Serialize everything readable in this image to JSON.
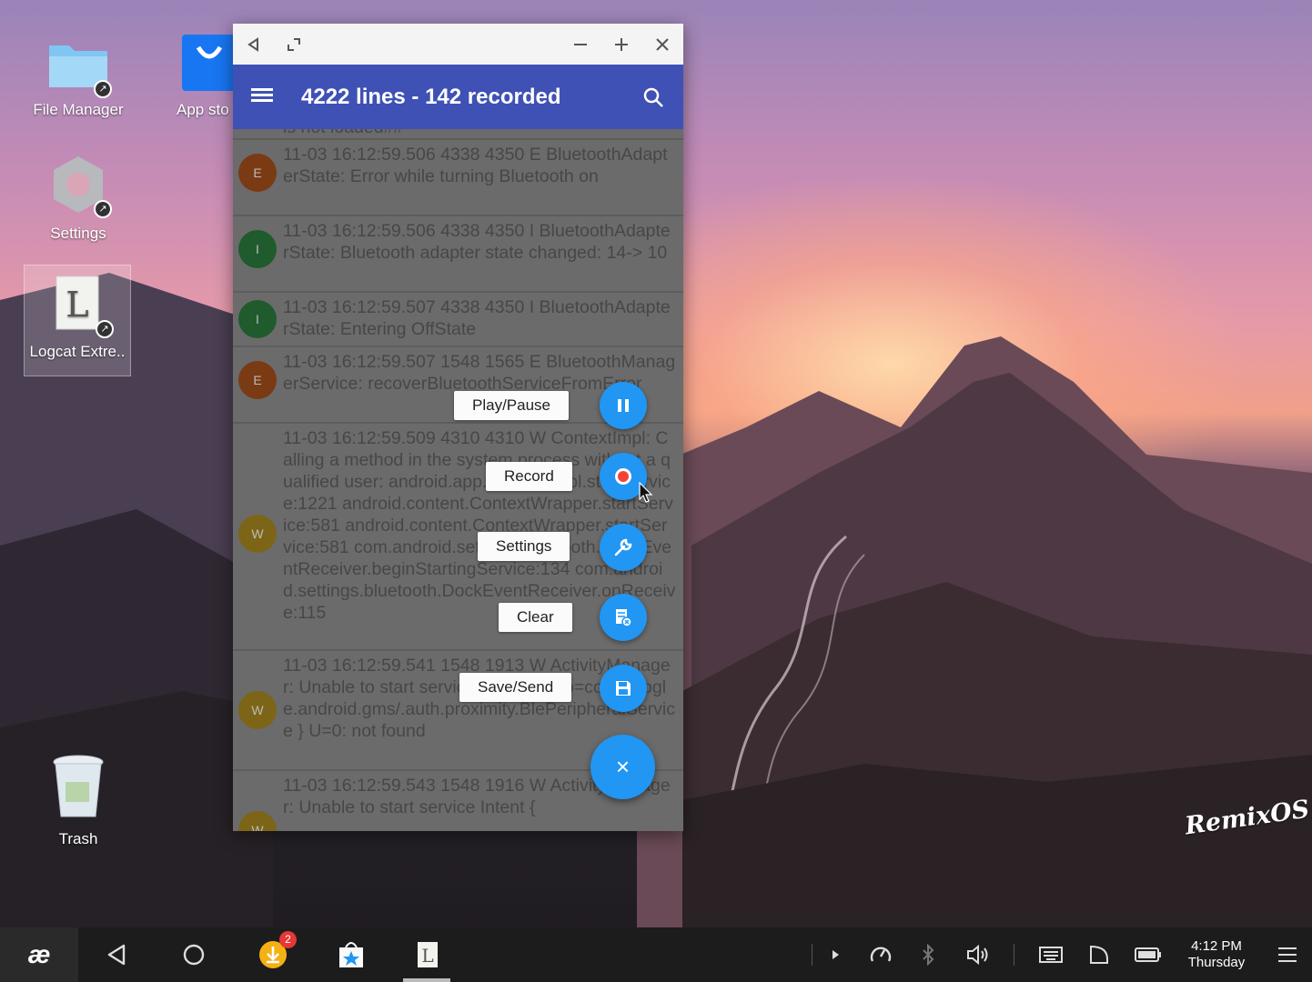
{
  "desktop": {
    "icons": [
      {
        "label": "File Manager"
      },
      {
        "label": "App sto"
      },
      {
        "label": "Settings"
      },
      {
        "label": "Logcat Extre.."
      },
      {
        "label": "Trash"
      }
    ],
    "brand": "RemixOS"
  },
  "window": {
    "title": "4222 lines - 142 recorded",
    "partial_top_line": "is not loaded##",
    "logs": [
      {
        "level": "E",
        "text": "11-03 16:12:59.506  4338  4350 E BluetoothAdapterState: Error while turning Bluetooth on"
      },
      {
        "level": "I",
        "text": "11-03 16:12:59.506  4338  4350 I BluetoothAdapterState: Bluetooth adapter state changed: 14-> 10"
      },
      {
        "level": "I",
        "text": "11-03 16:12:59.507  4338  4350 I BluetoothAdapterState: Entering OffState"
      },
      {
        "level": "E",
        "text": "11-03 16:12:59.507  1548  1565 E BluetoothManagerService: recoverBluetoothServiceFromError"
      },
      {
        "level": "W",
        "text": "11-03 16:12:59.509  4310  4310 W ContextImpl: Calling a method in the system process without a qualified user: android.app.ContextImpl.startService:1221 android.content.ContextWrapper.startService:581 android.content.ContextWrapper.startService:581 com.android.settings.bluetooth.DockEventReceiver.beginStartingService:134 com.android.settings.bluetooth.DockEventReceiver.onReceive:115"
      },
      {
        "level": "W",
        "text": "11-03 16:12:59.541  1548  1913 W ActivityManager: Unable to start service Intent { cmp=com.google.android.gms/.auth.proximity.BlePeripheralService } U=0: not found"
      },
      {
        "level": "W",
        "text": "11-03 16:12:59.543  1548  1916 W ActivityManager: Unable to start service Intent {"
      }
    ]
  },
  "fab_menu": {
    "play_pause": "Play/Pause",
    "record": "Record",
    "settings": "Settings",
    "clear": "Clear",
    "save_send": "Save/Send",
    "close": "×"
  },
  "taskbar": {
    "notification_count": "2",
    "time": "4:12 PM",
    "day": "Thursday"
  }
}
